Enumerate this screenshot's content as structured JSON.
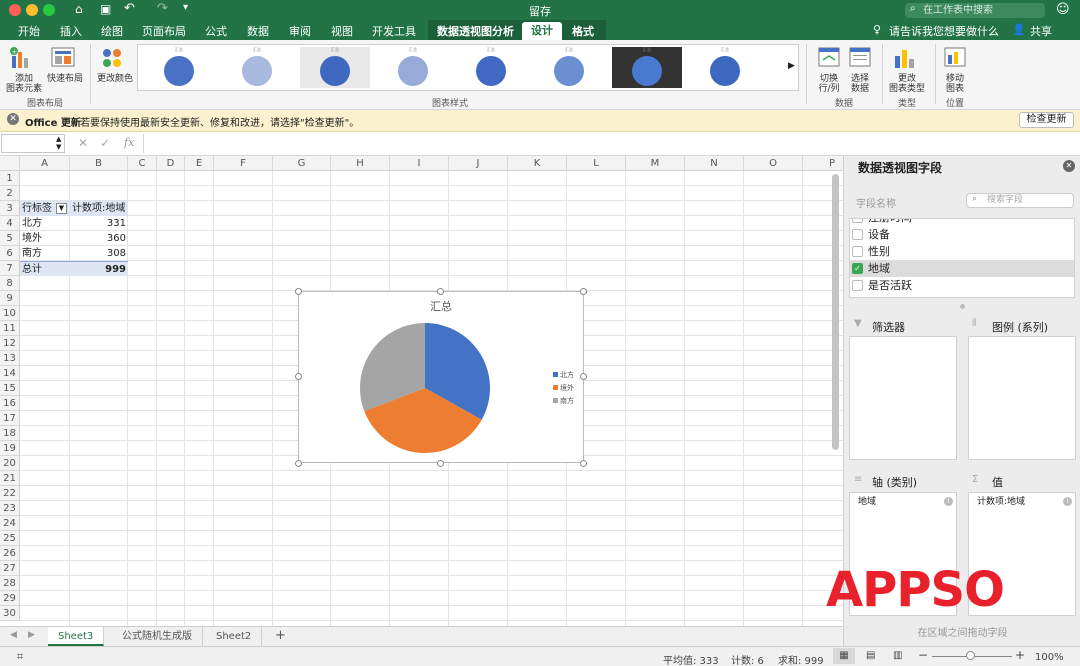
{
  "window": {
    "title": "留存",
    "search_placeholder": "在工作表中搜索"
  },
  "tabs": [
    "开始",
    "插入",
    "绘图",
    "页面布局",
    "公式",
    "数据",
    "审阅",
    "视图",
    "开发工具"
  ],
  "context_tab": "数据透视图分析",
  "active_tab": "设计",
  "format_tab": "格式",
  "tellme": "请告诉我您想要做什么",
  "share": "共享",
  "ribbon": {
    "add_element": "添加\n图表元素",
    "quick_layout": "快速布局",
    "change_colors": "更改颜色",
    "group_layout": "图表布局",
    "group_styles": "图表样式",
    "switch_rowcol": "切换\n行/列",
    "select_data": "选择\n数据",
    "group_data": "数据",
    "change_type": "更改\n图表类型",
    "group_type": "类型",
    "move_chart": "移动\n图表",
    "group_location": "位置",
    "gallery_styles": [
      {
        "title": "汇总",
        "color": "#4a72c4"
      },
      {
        "title": "汇总",
        "color": "#a7b9de"
      },
      {
        "title": "汇总",
        "color": "#3f69c0"
      },
      {
        "title": "汇总",
        "color": "#98aad8"
      },
      {
        "title": "汇总",
        "color": "#4168c2"
      },
      {
        "title": "汇总",
        "color": "#6b8fd0"
      },
      {
        "title": "汇总",
        "color": "#4a7ad0"
      },
      {
        "title": "汇总",
        "color": "#3d68c0"
      }
    ]
  },
  "notice": {
    "title": "Office 更新",
    "text": "若要保持使用最新安全更新、修复和改进，请选择\"检查更新\"。",
    "button": "检查更新"
  },
  "formula": {
    "fx": "fx"
  },
  "columns": [
    "A",
    "B",
    "C",
    "D",
    "E",
    "F",
    "G",
    "H",
    "I",
    "J",
    "K",
    "L",
    "M",
    "N",
    "O",
    "P"
  ],
  "rows": [
    "1",
    "2",
    "3",
    "4",
    "5",
    "6",
    "7",
    "8",
    "9",
    "10",
    "11",
    "12",
    "13",
    "14",
    "15",
    "16",
    "17",
    "18",
    "19",
    "20",
    "21",
    "22",
    "23",
    "24",
    "25",
    "26",
    "27",
    "28",
    "29",
    "30"
  ],
  "pivot": {
    "header_label": "行标签",
    "header_value": "计数项:地域",
    "rows": [
      {
        "label": "北方",
        "value": "331"
      },
      {
        "label": "境外",
        "value": "360"
      },
      {
        "label": "南方",
        "value": "308"
      }
    ],
    "total_label": "总计",
    "total_value": "999"
  },
  "chart_data": {
    "type": "pie",
    "title": "汇总",
    "categories": [
      "北方",
      "境外",
      "南方"
    ],
    "values": [
      331,
      360,
      308
    ],
    "colors": [
      "#4472c4",
      "#ed7d31",
      "#a5a5a5"
    ],
    "legend": "right"
  },
  "sheets": [
    "Sheet3",
    "公式随机生成版",
    "Sheet2"
  ],
  "active_sheet": "Sheet3",
  "status": {
    "avg": "平均值: 333",
    "count": "计数: 6",
    "sum": "求和: 999",
    "zoom": "100%"
  },
  "pane": {
    "title": "数据透视图字段",
    "field_name": "字段名称",
    "search_placeholder": "搜索字段",
    "fields": [
      {
        "label": "注册时间",
        "checked": false
      },
      {
        "label": "设备",
        "checked": false
      },
      {
        "label": "性别",
        "checked": false
      },
      {
        "label": "地域",
        "checked": true
      },
      {
        "label": "是否活跃",
        "checked": false
      }
    ],
    "filters": "筛选器",
    "legend": "图例 (系列)",
    "axis": "轴 (类别)",
    "values": "值",
    "axis_item": "地域",
    "values_item": "计数项:地域",
    "drag_hint": "在区域之间拖动字段"
  },
  "watermark": "APPSO"
}
